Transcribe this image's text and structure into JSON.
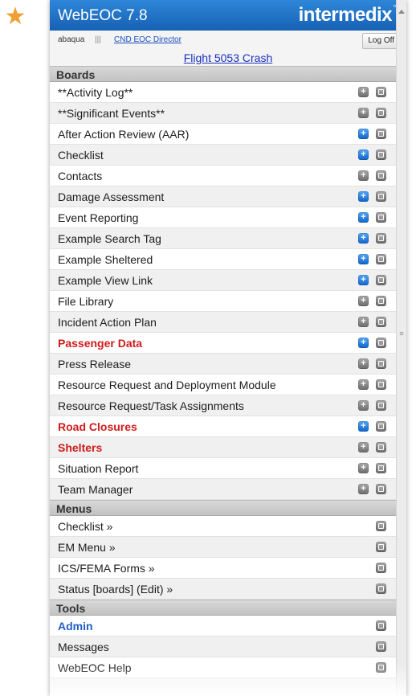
{
  "decor": {
    "star_glyph": "★"
  },
  "app": {
    "title": "WebEOC 7.8",
    "brand": "intermedix",
    "brand_mark": "™",
    "user": "abaqua",
    "separator": "|||",
    "position": "CND EOC Director",
    "logoff_label": "Log Off",
    "incident": "Flight 5053 Crash"
  },
  "icons": {
    "add": "+",
    "menu": ""
  },
  "colors": {
    "titlebar": "#1f75cf",
    "red_item": "#d01b1b",
    "blue_item": "#1f5fc4",
    "blue_icon": "#2a8ae8"
  },
  "sections": [
    {
      "header": "Boards",
      "items": [
        {
          "label": "**Activity Log**",
          "style": "normal",
          "add_blue": false,
          "has_add": true
        },
        {
          "label": "**Significant Events**",
          "style": "normal",
          "add_blue": false,
          "has_add": true
        },
        {
          "label": "After Action Review (AAR)",
          "style": "normal",
          "add_blue": true,
          "has_add": true
        },
        {
          "label": "Checklist",
          "style": "normal",
          "add_blue": true,
          "has_add": true
        },
        {
          "label": "Contacts",
          "style": "normal",
          "add_blue": false,
          "has_add": true
        },
        {
          "label": "Damage Assessment",
          "style": "normal",
          "add_blue": true,
          "has_add": true
        },
        {
          "label": "Event Reporting",
          "style": "normal",
          "add_blue": true,
          "has_add": true
        },
        {
          "label": "Example Search Tag",
          "style": "normal",
          "add_blue": true,
          "has_add": true
        },
        {
          "label": "Example Sheltered",
          "style": "normal",
          "add_blue": true,
          "has_add": true
        },
        {
          "label": "Example View Link",
          "style": "normal",
          "add_blue": true,
          "has_add": true
        },
        {
          "label": "File Library",
          "style": "normal",
          "add_blue": false,
          "has_add": true
        },
        {
          "label": "Incident Action Plan",
          "style": "normal",
          "add_blue": false,
          "has_add": true
        },
        {
          "label": "Passenger Data",
          "style": "red",
          "add_blue": true,
          "has_add": true
        },
        {
          "label": "Press Release",
          "style": "normal",
          "add_blue": false,
          "has_add": true
        },
        {
          "label": "Resource Request and Deployment Module",
          "style": "normal",
          "add_blue": false,
          "has_add": true
        },
        {
          "label": "Resource Request/Task Assignments",
          "style": "normal",
          "add_blue": false,
          "has_add": true
        },
        {
          "label": "Road Closures",
          "style": "red",
          "add_blue": true,
          "has_add": true
        },
        {
          "label": "Shelters",
          "style": "red",
          "add_blue": false,
          "has_add": true
        },
        {
          "label": "Situation Report",
          "style": "normal",
          "add_blue": false,
          "has_add": true
        },
        {
          "label": "Team Manager",
          "style": "normal",
          "add_blue": false,
          "has_add": true
        }
      ]
    },
    {
      "header": "Menus",
      "items": [
        {
          "label": "Checklist »",
          "style": "normal",
          "has_add": false
        },
        {
          "label": "EM Menu »",
          "style": "normal",
          "has_add": false
        },
        {
          "label": "ICS/FEMA Forms »",
          "style": "normal",
          "has_add": false
        },
        {
          "label": "Status [boards] (Edit) »",
          "style": "normal",
          "has_add": false
        }
      ]
    },
    {
      "header": "Tools",
      "items": [
        {
          "label": "Admin",
          "style": "blue",
          "has_add": false
        },
        {
          "label": "Messages",
          "style": "normal",
          "has_add": false
        },
        {
          "label": "WebEOC Help",
          "style": "normal",
          "has_add": false
        }
      ]
    }
  ]
}
